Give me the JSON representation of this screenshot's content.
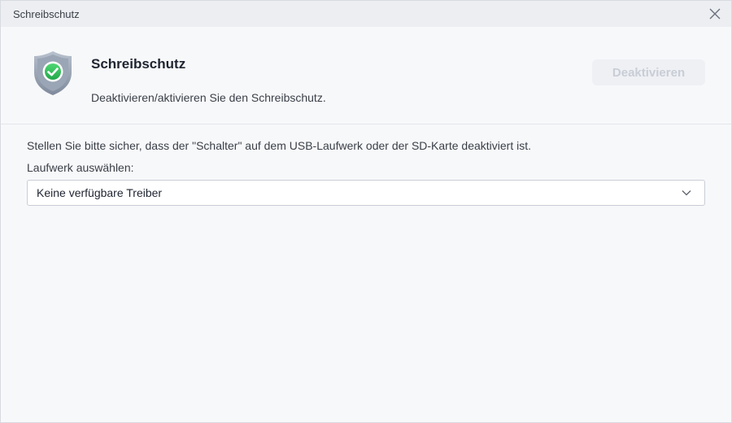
{
  "window": {
    "title": "Schreibschutz"
  },
  "header": {
    "title": "Schreibschutz",
    "description": "Deaktivieren/aktivieren Sie den Schreibschutz.",
    "button_label": "Deaktivieren",
    "icon": "shield-check-icon"
  },
  "main": {
    "hint": "Stellen Sie bitte sicher, dass der \"Schalter\" auf dem USB-Laufwerk oder der SD-Karte deaktiviert ist.",
    "drive_label": "Laufwerk auswählen:",
    "drive_select": {
      "value": "Keine verfügbare Treiber"
    }
  },
  "colors": {
    "accent_green": "#2fbf5a",
    "shield_gray": "#8f9aab",
    "disabled_button_text": "#c9cdd6"
  }
}
